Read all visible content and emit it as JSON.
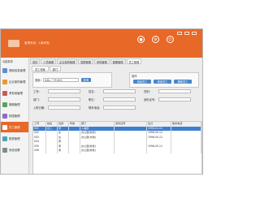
{
  "brand": {
    "name": "管理系统",
    "subtitle": "人事考勤"
  },
  "colors": {
    "accent": "#e86828",
    "selected_row": "#3f7fd0"
  },
  "sidebar": {
    "title": "功能菜单",
    "items": [
      {
        "label": "基础信息管理",
        "icon": "info-icon",
        "color": "#5b8fd2"
      },
      {
        "label": "企业架构管理",
        "icon": "org-icon",
        "color": "#e99a2e"
      },
      {
        "label": "考勤用管理",
        "icon": "clock-icon",
        "color": "#c85a5a"
      },
      {
        "label": "假期管理",
        "icon": "calendar-icon",
        "color": "#56a35c"
      },
      {
        "label": "权限管理",
        "icon": "lock-icon",
        "color": "#8e6ac6"
      },
      {
        "label": "员工管理",
        "icon": "user-icon",
        "color": "#ffffff",
        "active": true
      },
      {
        "label": "报表管理",
        "icon": "report-icon",
        "color": "#4aa3b5"
      },
      {
        "label": "系统设置",
        "icon": "gear-icon",
        "color": "#7f8c8d"
      }
    ]
  },
  "navtabs": [
    "首页",
    "人员管理",
    "企业架构管理",
    "权限管理",
    "考勤管理",
    "假期管理",
    "员工管理"
  ],
  "form_tabs": [
    "员工档案",
    "部门"
  ],
  "search": {
    "label": "搜索:",
    "value": "请输入工号/姓名",
    "button": "查询"
  },
  "operations": {
    "label": "操作",
    "buttons": [
      "添加员工",
      "修改员工",
      "删除员工"
    ]
  },
  "form": {
    "fields": [
      {
        "label": "工号:",
        "value": ""
      },
      {
        "label": "姓名:",
        "value": ""
      },
      {
        "label": "性别:",
        "value": ""
      },
      {
        "label": "部门:",
        "value": ""
      },
      {
        "label": "职位:",
        "value": ""
      },
      {
        "label": "身份证号:",
        "value": ""
      },
      {
        "label": "入职日期:",
        "value": ""
      },
      {
        "label": "联系电话:",
        "value": ""
      }
    ]
  },
  "table": {
    "columns": [
      "工号",
      "姓名",
      "性别",
      "年龄",
      "部门",
      "身份证号",
      "生日",
      "联系电话"
    ],
    "rows": [
      [
        "001",
        "张三",
        "男",
        "",
        "人事部",
        "",
        "1996-01-01",
        ""
      ],
      [
        "002",
        "",
        "女",
        "",
        "办公室(财务)",
        "",
        "1996-05-12",
        ""
      ],
      [
        "003",
        "",
        "女",
        "",
        "办公室(市场)",
        "",
        "1996-05-12",
        ""
      ],
      [
        "004",
        "",
        "男",
        "",
        "",
        "",
        "",
        ""
      ],
      [
        "005",
        "",
        "男",
        "",
        "办公室(财务)",
        "",
        "1996-05-11",
        ""
      ],
      [
        "006",
        "",
        "男",
        "",
        "办公室(财务)",
        "",
        "",
        ""
      ]
    ],
    "selected_index": 0
  }
}
